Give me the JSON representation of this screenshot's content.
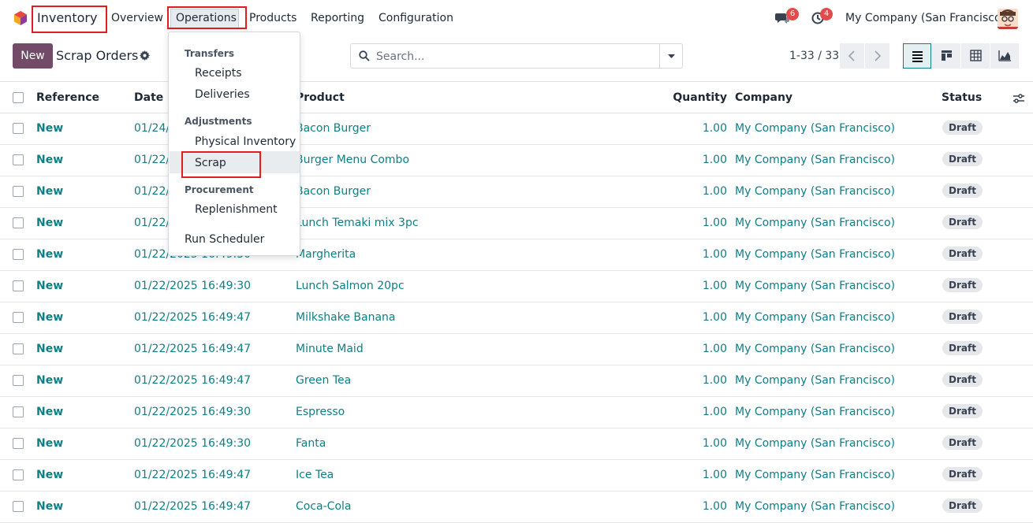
{
  "navbar": {
    "app_name": "Inventory",
    "menu": [
      "Overview",
      "Operations",
      "Products",
      "Reporting",
      "Configuration"
    ],
    "messages_count": "6",
    "activities_count": "4",
    "company": "My Company (San Francisco)"
  },
  "control_panel": {
    "new_label": "New",
    "title": "Scrap Orders",
    "search_placeholder": "Search...",
    "pager": "1-33 / 33"
  },
  "table": {
    "headers": [
      "Reference",
      "Date",
      "Product",
      "Quantity",
      "Company",
      "Status"
    ],
    "rows": [
      {
        "ref": "New",
        "date": "01/24/",
        "product": "Bacon Burger",
        "qty": "1.00",
        "company": "My Company (San Francisco)",
        "status": "Draft"
      },
      {
        "ref": "New",
        "date": "01/22/",
        "product": "Burger Menu Combo",
        "qty": "1.00",
        "company": "My Company (San Francisco)",
        "status": "Draft"
      },
      {
        "ref": "New",
        "date": "01/22/",
        "product": "Bacon Burger",
        "qty": "1.00",
        "company": "My Company (San Francisco)",
        "status": "Draft"
      },
      {
        "ref": "New",
        "date": "01/22/",
        "product": "Lunch Temaki mix 3pc",
        "qty": "1.00",
        "company": "My Company (San Francisco)",
        "status": "Draft"
      },
      {
        "ref": "New",
        "date": "01/22/2025 16:49:30",
        "product": "Margherita",
        "qty": "1.00",
        "company": "My Company (San Francisco)",
        "status": "Draft"
      },
      {
        "ref": "New",
        "date": "01/22/2025 16:49:30",
        "product": "Lunch Salmon 20pc",
        "qty": "1.00",
        "company": "My Company (San Francisco)",
        "status": "Draft"
      },
      {
        "ref": "New",
        "date": "01/22/2025 16:49:47",
        "product": "Milkshake Banana",
        "qty": "1.00",
        "company": "My Company (San Francisco)",
        "status": "Draft"
      },
      {
        "ref": "New",
        "date": "01/22/2025 16:49:47",
        "product": "Minute Maid",
        "qty": "1.00",
        "company": "My Company (San Francisco)",
        "status": "Draft"
      },
      {
        "ref": "New",
        "date": "01/22/2025 16:49:47",
        "product": "Green Tea",
        "qty": "1.00",
        "company": "My Company (San Francisco)",
        "status": "Draft"
      },
      {
        "ref": "New",
        "date": "01/22/2025 16:49:30",
        "product": "Espresso",
        "qty": "1.00",
        "company": "My Company (San Francisco)",
        "status": "Draft"
      },
      {
        "ref": "New",
        "date": "01/22/2025 16:49:30",
        "product": "Fanta",
        "qty": "1.00",
        "company": "My Company (San Francisco)",
        "status": "Draft"
      },
      {
        "ref": "New",
        "date": "01/22/2025 16:49:47",
        "product": "Ice Tea",
        "qty": "1.00",
        "company": "My Company (San Francisco)",
        "status": "Draft"
      },
      {
        "ref": "New",
        "date": "01/22/2025 16:49:47",
        "product": "Coca-Cola",
        "qty": "1.00",
        "company": "My Company (San Francisco)",
        "status": "Draft"
      }
    ]
  },
  "dropdown": {
    "transfers_header": "Transfers",
    "receipts": "Receipts",
    "deliveries": "Deliveries",
    "adjustments_header": "Adjustments",
    "physical_inventory": "Physical Inventory",
    "scrap": "Scrap",
    "procurement_header": "Procurement",
    "replenishment": "Replenishment",
    "run_scheduler": "Run Scheduler"
  },
  "colors": {
    "accent": "#714b67",
    "link": "#0d7f85",
    "highlight": "#e11d1d"
  }
}
